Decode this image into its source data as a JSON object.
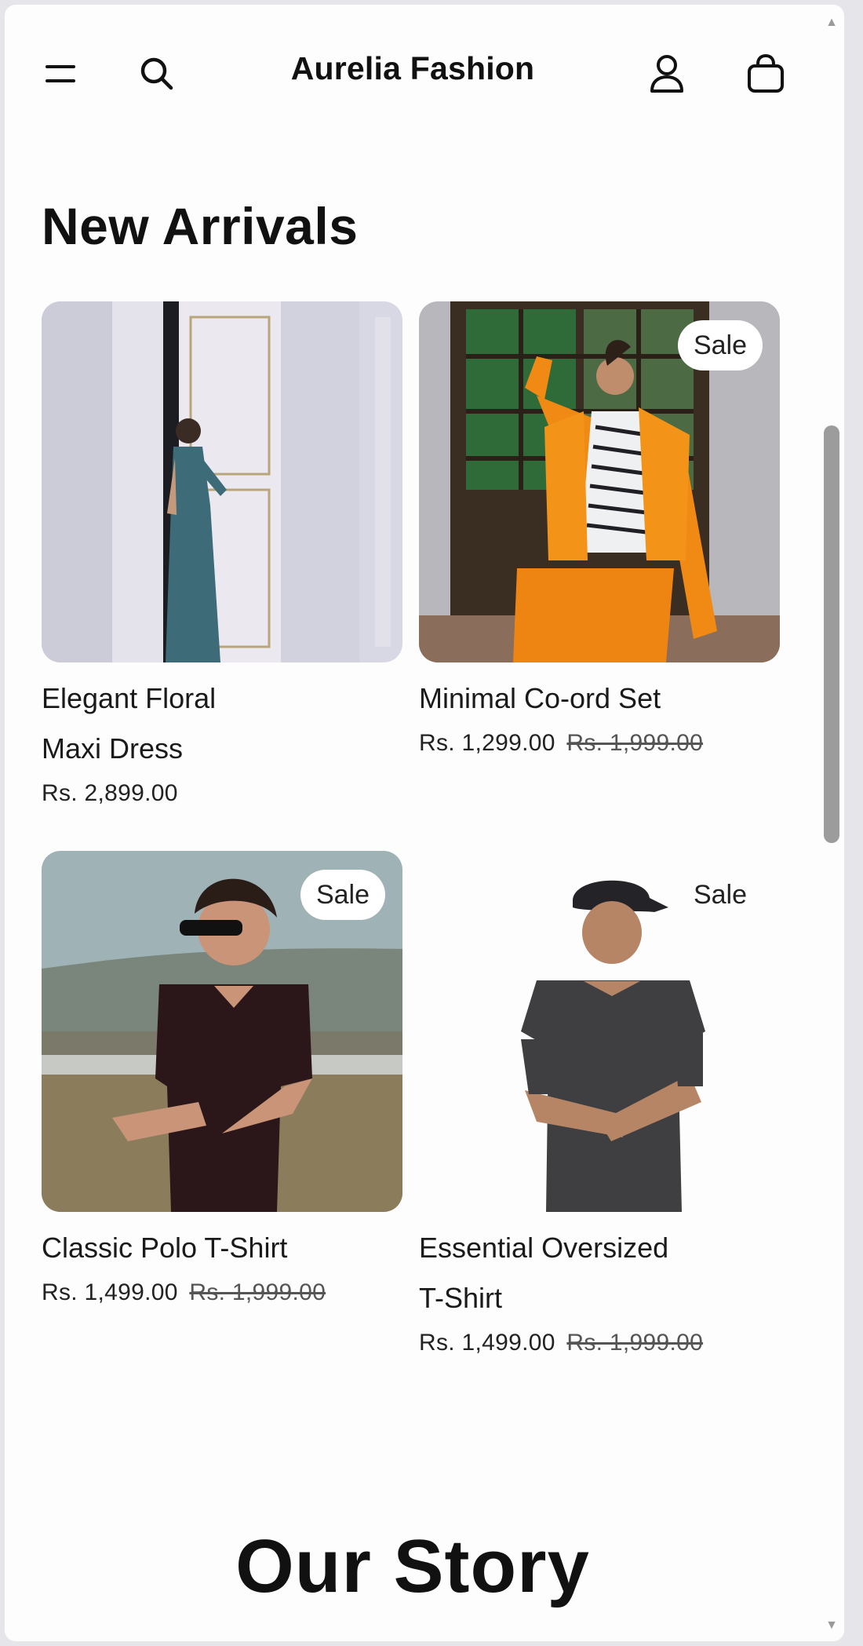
{
  "header": {
    "brand": "Aurelia Fashion",
    "icons": [
      "menu-icon",
      "search-icon",
      "account-icon",
      "cart-icon"
    ]
  },
  "new_arrivals": {
    "title": "New Arrivals",
    "products": [
      {
        "name_line1": "Elegant Floral",
        "name_line2": "Maxi Dress",
        "price": "Rs. 2,899.00",
        "old_price": "",
        "badge": ""
      },
      {
        "name_line1": "Minimal Co-ord Set",
        "name_line2": "",
        "price": "Rs. 1,299.00",
        "old_price": "Rs. 1,999.00",
        "badge": "Sale"
      },
      {
        "name_line1": "Classic Polo T-Shirt",
        "name_line2": "",
        "price": "Rs. 1,499.00",
        "old_price": "Rs. 1,999.00",
        "badge": "Sale"
      },
      {
        "name_line1": "Essential Oversized",
        "name_line2": "T-Shirt",
        "price": "Rs. 1,499.00",
        "old_price": "Rs. 1,999.00",
        "badge": "Sale"
      }
    ]
  },
  "story": {
    "title": "Our Story"
  },
  "colors": {
    "background": "#fdfdfe",
    "text": "#111111",
    "badge_bg": "#ffffff",
    "scrollbar": "#9c9c9c",
    "accent_orange": "#f08a14"
  }
}
